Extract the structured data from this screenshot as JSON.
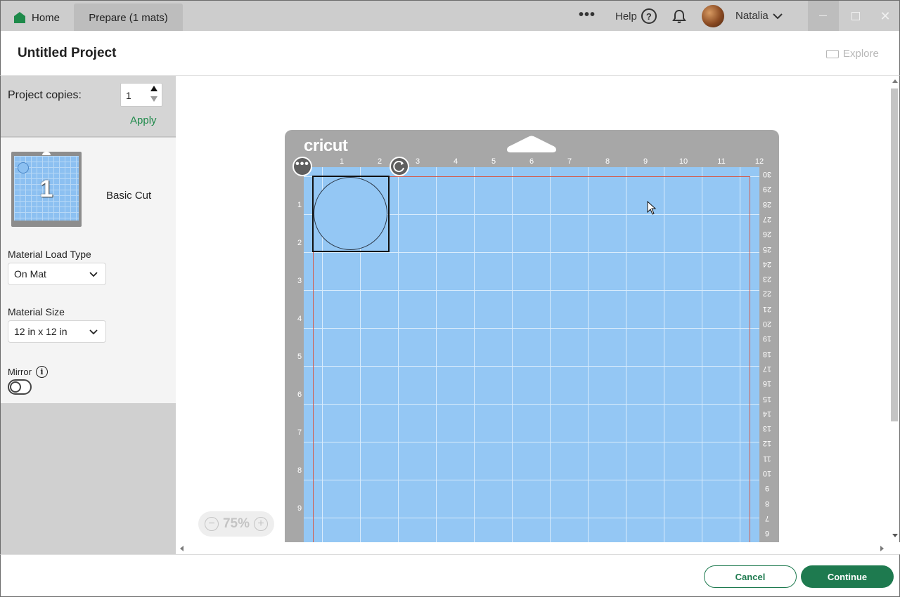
{
  "titlebar": {
    "home_tab": "Home",
    "prepare_tab": "Prepare (1 mats)",
    "more_label": "•••",
    "help_label": "Help",
    "help_icon": "?",
    "user_name": "Natalia",
    "close_glyph": "✕"
  },
  "header": {
    "title": "Untitled Project",
    "explore_label": "Explore"
  },
  "sidebar": {
    "copies_label": "Project copies:",
    "copies_value": "1",
    "apply_label": "Apply",
    "mat_number": "1",
    "cut_type": "Basic Cut",
    "material_load_label": "Material Load Type",
    "material_load_value": "On Mat",
    "material_size_label": "Material Size",
    "material_size_value": "12 in x 12 in",
    "mirror_label": "Mirror",
    "mirror_on": false
  },
  "mat": {
    "brand": "cricut",
    "more_label": "•••",
    "top_ruler": [
      "1",
      "2",
      "3",
      "4",
      "5",
      "6",
      "7",
      "8",
      "9",
      "10",
      "11",
      "12"
    ],
    "left_ruler": [
      "1",
      "2",
      "3",
      "4",
      "5",
      "6",
      "7",
      "8",
      "9"
    ],
    "right_ruler": [
      "30",
      "29",
      "28",
      "27",
      "26",
      "25",
      "24",
      "23",
      "22",
      "21",
      "20",
      "19",
      "18",
      "17",
      "16",
      "15",
      "14",
      "13",
      "12",
      "11",
      "10",
      "9",
      "8",
      "7",
      "6"
    ],
    "colors": {
      "mat_blue": "#94c7f4",
      "mat_gray": "#a7a7a7",
      "cut_border": "#d45a4a"
    }
  },
  "zoom": {
    "value": "75%",
    "minus": "−",
    "plus": "+"
  },
  "footer": {
    "cancel_label": "Cancel",
    "continue_label": "Continue"
  },
  "colors": {
    "accent_green": "#1e7a4f",
    "apply_green": "#1e8a4a"
  }
}
